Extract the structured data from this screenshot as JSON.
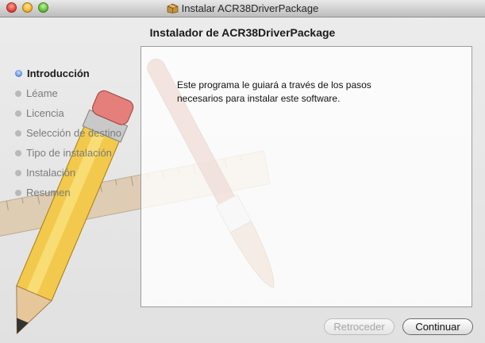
{
  "window": {
    "title": "Instalar ACR38DriverPackage"
  },
  "header": {
    "title": "Instalador de ACR38DriverPackage"
  },
  "steps": [
    {
      "label": "Introducción",
      "active": true
    },
    {
      "label": "Léame",
      "active": false
    },
    {
      "label": "Licencia",
      "active": false
    },
    {
      "label": "Selección de destino",
      "active": false
    },
    {
      "label": "Tipo de instalación",
      "active": false
    },
    {
      "label": "Instalación",
      "active": false
    },
    {
      "label": "Resumen",
      "active": false
    }
  ],
  "content": {
    "text": "Este programa le guiará a través de los pasos\nnecesarios para instalar este software."
  },
  "buttons": {
    "back": "Retroceder",
    "continue": "Continuar"
  },
  "icons": {
    "app": "package-icon",
    "background": "pencil-ruler-brush-artwork"
  }
}
